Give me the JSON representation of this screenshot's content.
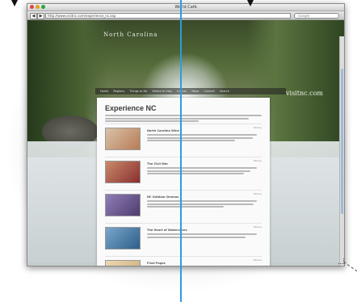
{
  "window": {
    "title": "World Café",
    "url": "http://www.visitnc.com/experience_nc.asp",
    "search_placeholder": "Google",
    "back_label": "◀",
    "forward_label": "▶"
  },
  "site": {
    "header_title": "North Carolina",
    "brand": "visitnc.com",
    "nav": [
      "Home",
      "Regions",
      "Things to Do",
      "Where to Stay",
      "Events",
      "Maps",
      "Contact",
      "Search"
    ]
  },
  "content": {
    "heading": "Experience NC",
    "articles": [
      {
        "title": "North Carolina Wine",
        "more": "More ▸",
        "thumb_color": "#b77b56"
      },
      {
        "title": "The Civil War",
        "more": "More ▸",
        "thumb_color": "#8a2f2f"
      },
      {
        "title": "NC Outdoor Dramas",
        "more": "More ▸",
        "thumb_color": "#4f3b6d"
      },
      {
        "title": "The Heart of Watercolors",
        "more": "More ▸",
        "thumb_color": "#2c5f8a"
      },
      {
        "title": "Final Pages",
        "more": "More ▸",
        "thumb_color": "#c9a977"
      }
    ]
  },
  "colors": {
    "accent_line": "#2a9de0",
    "close": "#e0443e",
    "minimize": "#dea123",
    "zoom": "#27a83b"
  }
}
